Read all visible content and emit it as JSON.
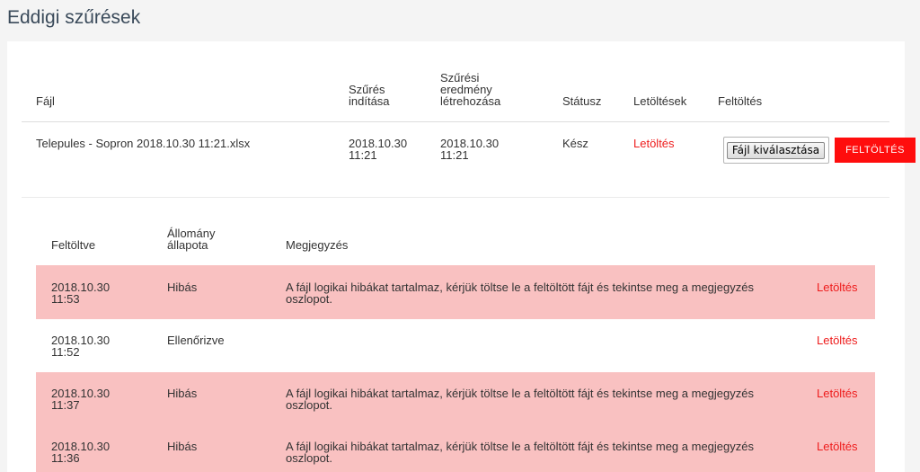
{
  "page": {
    "title": "Eddigi szűrések"
  },
  "table": {
    "headers": {
      "file": "Fájl",
      "start_l1": "Szűrés",
      "start_l2": "indítása",
      "result_l1": "Szűrési",
      "result_l2": "eredmény",
      "result_l3": "létrehozása",
      "status": "Státusz",
      "downloads": "Letöltések",
      "upload": "Feltöltés"
    },
    "row": {
      "file": "Telepules - Sopron 2018.10.30 11:21.xlsx",
      "start_date": "2018.10.30",
      "start_time": "11:21",
      "result_date": "2018.10.30",
      "result_time": "11:21",
      "status": "Kész",
      "download": "Letöltés",
      "choose_file": "Fájl kiválasztása",
      "upload_button": "FELTÖLTÉS"
    }
  },
  "uploads": {
    "headers": {
      "uploaded": "Feltöltve",
      "state_l1": "Állomány",
      "state_l2": "állapota",
      "note": "Megjegyzés"
    },
    "rows": [
      {
        "date": "2018.10.30",
        "time": "11:53",
        "state": "Hibás",
        "note_l1": "A fájl logikai hibákat tartalmaz, kérjük töltse le a feltöltött fájt és tekintse meg a megjegyzés",
        "note_l2": "oszlopot.",
        "download": "Letöltés",
        "error": true
      },
      {
        "date": "2018.10.30",
        "time": "11:52",
        "state": "Ellenőrizve",
        "note_l1": "",
        "note_l2": "",
        "download": "Letöltés",
        "error": false
      },
      {
        "date": "2018.10.30",
        "time": "11:37",
        "state": "Hibás",
        "note_l1": "A fájl logikai hibákat tartalmaz, kérjük töltse le a feltöltött fájt és tekintse meg a megjegyzés",
        "note_l2": "oszlopot.",
        "download": "Letöltés",
        "error": true
      },
      {
        "date": "2018.10.30",
        "time": "11:36",
        "state": "Hibás",
        "note_l1": "A fájl logikai hibákat tartalmaz, kérjük töltse le a feltöltött fájt és tekintse meg a megjegyzés",
        "note_l2": "oszlopot.",
        "download": "Letöltés",
        "error": true
      }
    ]
  },
  "colors": {
    "accent": "#ee1c1c",
    "error_row": "#f9c1c1"
  }
}
